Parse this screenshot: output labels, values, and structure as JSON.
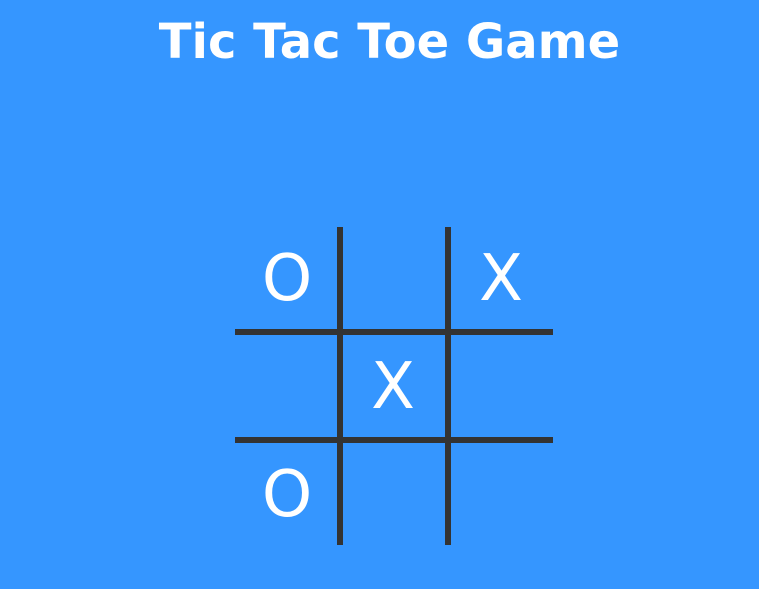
{
  "game": {
    "title": "Tic Tac Toe Game",
    "board": {
      "cells": [
        "O",
        "",
        "X",
        "",
        "X",
        "",
        "O",
        "",
        ""
      ]
    }
  },
  "colors": {
    "background": "#3596FF",
    "text": "#FFFFFF",
    "grid_lines": "#333333"
  }
}
